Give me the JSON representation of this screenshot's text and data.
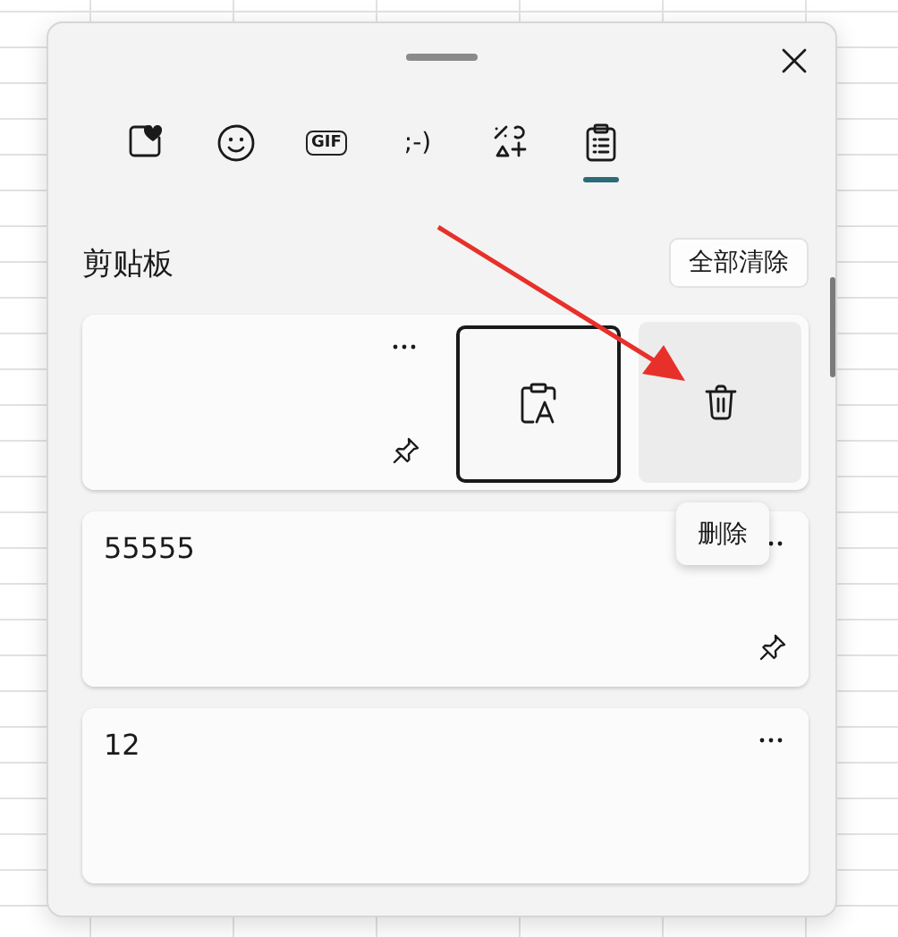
{
  "tabs": [
    {
      "kind": "favorites",
      "selected": false
    },
    {
      "kind": "emoji",
      "selected": false
    },
    {
      "kind": "gif",
      "label": "GIF",
      "selected": false
    },
    {
      "kind": "kaomoji",
      "label": ";-)",
      "selected": false
    },
    {
      "kind": "symbols",
      "selected": false
    },
    {
      "kind": "clipboard",
      "selected": true
    }
  ],
  "header": {
    "title": "剪贴板",
    "clear_button": "全部清除"
  },
  "items": [
    {
      "kind": "actions"
    },
    {
      "kind": "text",
      "text": "55555"
    },
    {
      "kind": "text",
      "text": "12",
      "pin_hidden": true
    }
  ],
  "tooltip": {
    "text": "删除"
  }
}
